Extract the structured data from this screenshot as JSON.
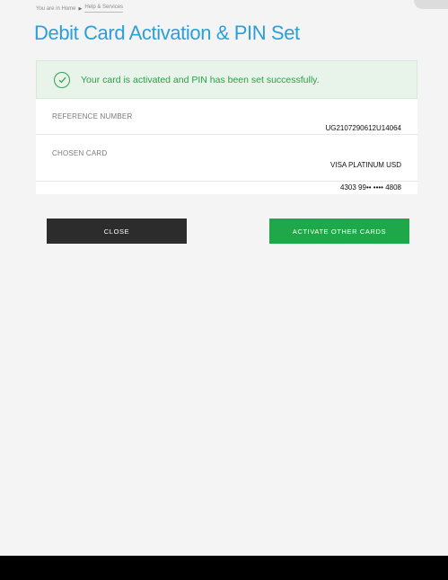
{
  "breadcrumb": {
    "prefix": "You are in Home",
    "current": "Help & Services"
  },
  "page_title": "Debit Card Activation & PIN Set",
  "success_message": "Your card is activated and PIN has been set successfully.",
  "details": {
    "reference_label": "REFERENCE NUMBER",
    "reference_value": "UG2107290612U14064",
    "card_label": "CHOSEN CARD",
    "card_type": "VISA PLATINUM USD",
    "card_number": "4303 99•• •••• 4808"
  },
  "buttons": {
    "close": "CLOSE",
    "activate_other": "ACTIVATE OTHER CARDS"
  },
  "colors": {
    "title": "#2b9fd6",
    "success_text": "#23a346",
    "success_bg": "#e8f3ea",
    "close_btn": "#2c2c2c",
    "activate_btn": "#1ea84a"
  },
  "icons": {
    "success": "check-circle-icon",
    "breadcrumb_separator": "chevron-right-icon"
  }
}
